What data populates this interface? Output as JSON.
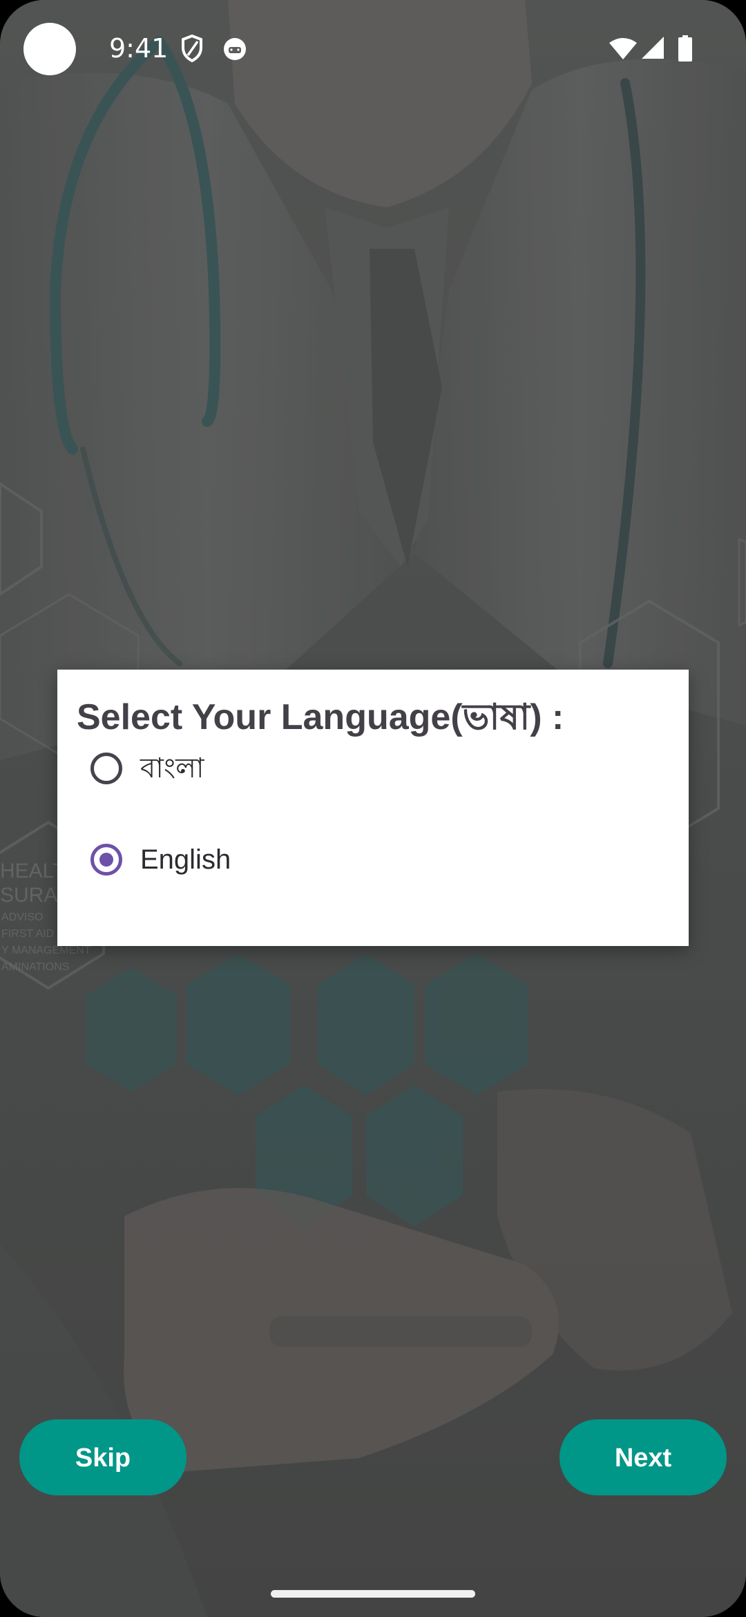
{
  "status_bar": {
    "time": "9:41",
    "icons": [
      "shield-icon",
      "android-debug-icon",
      "wifi-icon",
      "signal-icon",
      "battery-icon"
    ]
  },
  "dialog": {
    "title": "Select Your Language(ভাষা) :",
    "options": [
      {
        "label": "বাংলা",
        "selected": false
      },
      {
        "label": "English",
        "selected": true
      }
    ]
  },
  "buttons": {
    "skip_label": "Skip",
    "next_label": "Next"
  },
  "background": {
    "hex_labels": [
      "HEALTH",
      "SURAN",
      "ADVISO",
      "FIRST AID",
      "Y MANAGEMENT",
      "AMINATIONS"
    ]
  },
  "colors": {
    "accent": "#009688",
    "radio_selected": "#6e51a8",
    "dialog_bg": "#ffffff",
    "title_text": "#434048"
  }
}
